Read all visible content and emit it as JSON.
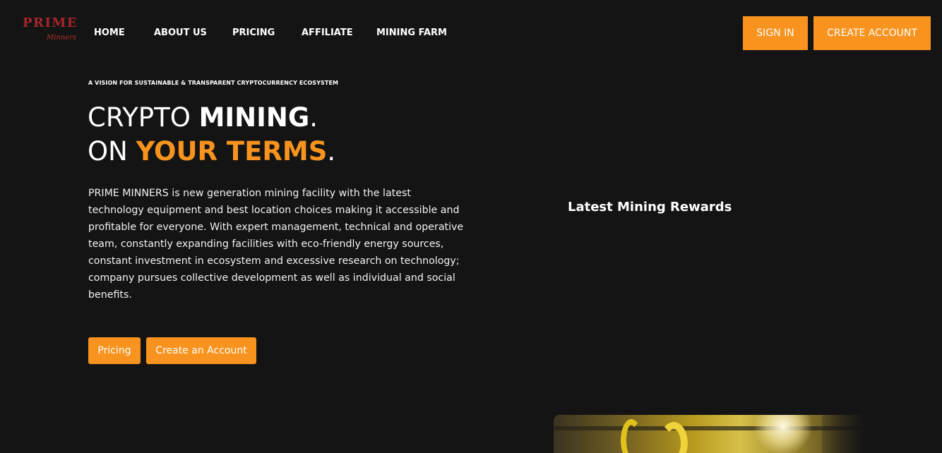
{
  "brand": {
    "name": "PRIME",
    "sub": "Minners"
  },
  "nav": {
    "items": [
      {
        "label": "HOME"
      },
      {
        "label": "ABOUT US"
      },
      {
        "label": "PRICING"
      },
      {
        "label": "AFFILIATE"
      },
      {
        "label": "MINING FARM"
      }
    ]
  },
  "header_actions": {
    "sign_in": "SIGN IN",
    "create_account": "CREATE ACCOUNT"
  },
  "hero": {
    "tagline": "A VISION FOR SUSTAINABLE & TRANSPARENT CRYPTOCURRENCY ECOSYSTEM",
    "headline_line1_light": "CRYPTO ",
    "headline_line1_bold": "MINING",
    "headline_line1_end": ".",
    "headline_line2_light": "ON ",
    "headline_line2_accent": "YOUR TERMS",
    "headline_line2_end": ".",
    "description": "PRIME MINNERS is new generation mining facility with the latest technology equipment and best location choices making it accessible and profitable for everyone. With expert management, technical and operative team, constantly expanding facilities with eco-friendly energy sources, constant investment in ecosystem and excessive research on technology; company pursues collective development as well as individual and social benefits.",
    "btn_pricing": "Pricing",
    "btn_create": "Create an Account"
  },
  "rewards": {
    "title": "Latest Mining Rewards"
  },
  "colors": {
    "background": "#141414",
    "accent": "#f7931e",
    "brand_red": "#a5262a"
  }
}
